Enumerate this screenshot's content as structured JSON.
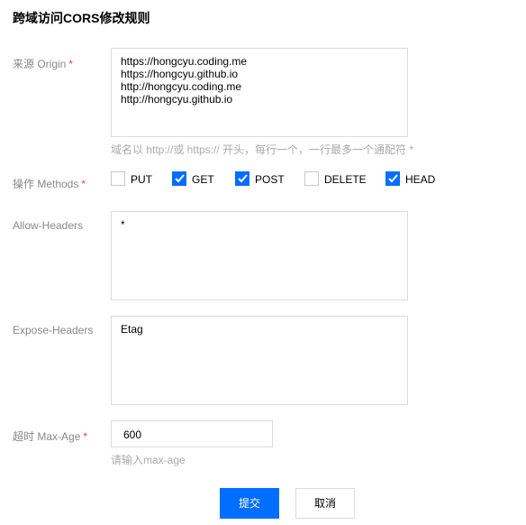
{
  "title": "跨域访问CORS修改规则",
  "origin": {
    "label": "来源 Origin",
    "required": "*",
    "lines": [
      "https://hongcyu.coding.me",
      "https://hongcyu.github.io",
      "http://hongcyu.coding.me",
      "http://hongcyu.github.io"
    ],
    "hint": "域名以 http://或 https:// 开头，每行一个，一行最多一个通配符 *"
  },
  "methods": {
    "label": "操作 Methods",
    "required": "*",
    "items": [
      {
        "label": "PUT",
        "checked": false
      },
      {
        "label": "GET",
        "checked": true
      },
      {
        "label": "POST",
        "checked": true
      },
      {
        "label": "DELETE",
        "checked": false
      },
      {
        "label": "HEAD",
        "checked": true
      }
    ]
  },
  "allow_headers": {
    "label": "Allow-Headers",
    "value": "*"
  },
  "expose_headers": {
    "label": "Expose-Headers",
    "value": "Etag"
  },
  "max_age": {
    "label": "超时 Max-Age",
    "required": "*",
    "value": "600",
    "hint": "请输入max-age"
  },
  "buttons": {
    "submit": "提交",
    "cancel": "取消"
  },
  "colors": {
    "primary": "#006eff",
    "required": "#e54545"
  }
}
